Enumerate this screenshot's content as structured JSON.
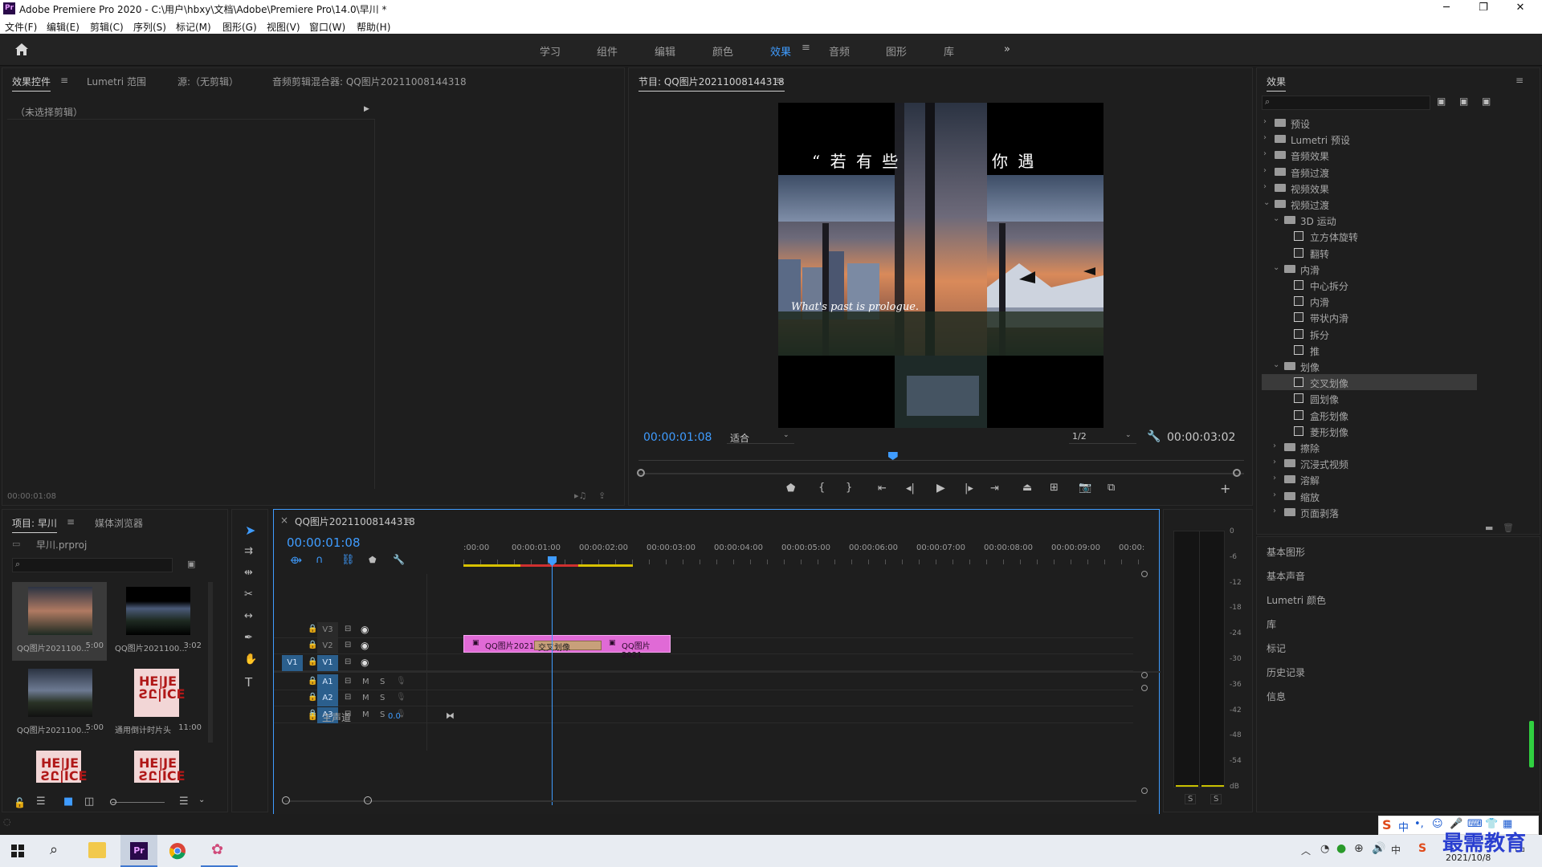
{
  "window": {
    "app_icon": "Pr",
    "title": "Adobe Premiere Pro 2020 - C:\\用户\\hbxy\\文档\\Adobe\\Premiere Pro\\14.0\\早川 *",
    "min": "─",
    "max": "❐",
    "close": "✕"
  },
  "menu": [
    "文件(F)",
    "编辑(E)",
    "剪辑(C)",
    "序列(S)",
    "标记(M)",
    "图形(G)",
    "视图(V)",
    "窗口(W)",
    "帮助(H)"
  ],
  "workspaces": {
    "items": [
      "学习",
      "组件",
      "编辑",
      "颜色",
      "效果",
      "音频",
      "图形",
      "库"
    ],
    "active": "效果",
    "more": "»"
  },
  "source_panel": {
    "tabs": [
      "效果控件",
      "Lumetri 范围",
      "源:（无剪辑）",
      "音频剪辑混合器: QQ图片20211008144318"
    ],
    "no_clip": "（未选择剪辑）",
    "timecode": "00:00:01:08"
  },
  "program_monitor": {
    "title": "节目: QQ图片20211008144318",
    "video_text_top_left": "“ 若 有 些",
    "video_text_top_right": "你 遇",
    "video_text_script": "What's past is prologue.",
    "timecode": "00:00:01:08",
    "fit": "适合",
    "resolution": "1/2",
    "duration": "00:00:03:02",
    "playhead_fraction": 0.42
  },
  "effects_panel": {
    "title": "效果",
    "tree": [
      {
        "level": 0,
        "type": "folder",
        "open": false,
        "label": "预设"
      },
      {
        "level": 0,
        "type": "folder",
        "open": false,
        "label": "Lumetri 预设"
      },
      {
        "level": 0,
        "type": "folder",
        "open": false,
        "label": "音频效果"
      },
      {
        "level": 0,
        "type": "folder",
        "open": false,
        "label": "音频过渡"
      },
      {
        "level": 0,
        "type": "folder",
        "open": false,
        "label": "视频效果"
      },
      {
        "level": 0,
        "type": "folder",
        "open": true,
        "label": "视频过渡"
      },
      {
        "level": 1,
        "type": "folder",
        "open": true,
        "label": "3D 运动"
      },
      {
        "level": 2,
        "type": "fx",
        "label": "立方体旋转"
      },
      {
        "level": 2,
        "type": "fx",
        "label": "翻转"
      },
      {
        "level": 1,
        "type": "folder",
        "open": true,
        "label": "内滑"
      },
      {
        "level": 2,
        "type": "fx",
        "label": "中心拆分"
      },
      {
        "level": 2,
        "type": "fx",
        "label": "内滑"
      },
      {
        "level": 2,
        "type": "fx",
        "label": "带状内滑"
      },
      {
        "level": 2,
        "type": "fx",
        "label": "拆分"
      },
      {
        "level": 2,
        "type": "fx",
        "label": "推"
      },
      {
        "level": 1,
        "type": "folder",
        "open": true,
        "label": "划像"
      },
      {
        "level": 2,
        "type": "fx",
        "label": "交叉划像",
        "selected": true
      },
      {
        "level": 2,
        "type": "fx",
        "label": "圆划像"
      },
      {
        "level": 2,
        "type": "fx",
        "label": "盒形划像"
      },
      {
        "level": 2,
        "type": "fx",
        "label": "菱形划像"
      },
      {
        "level": 1,
        "type": "folder",
        "open": false,
        "label": "擦除"
      },
      {
        "level": 1,
        "type": "folder",
        "open": false,
        "label": "沉浸式视频"
      },
      {
        "level": 1,
        "type": "folder",
        "open": false,
        "label": "溶解"
      },
      {
        "level": 1,
        "type": "folder",
        "open": false,
        "label": "缩放"
      },
      {
        "level": 1,
        "type": "folder",
        "open": false,
        "label": "页面剥落"
      }
    ],
    "side_panels": [
      "基本图形",
      "基本声音",
      "Lumetri 颜色",
      "库",
      "标记",
      "历史记录",
      "信息"
    ]
  },
  "project_panel": {
    "tabs": [
      "项目: 早川",
      "媒体浏览器"
    ],
    "file": "早川.prproj",
    "items": [
      {
        "name": "QQ图片2021100...",
        "dur": "5:00",
        "kind": "photo1"
      },
      {
        "name": "QQ图片2021100...",
        "dur": "3:02",
        "kind": "photo2"
      },
      {
        "name": "QQ图片2021100...",
        "dur": "5:00",
        "kind": "photo3"
      },
      {
        "name": "通用倒计时片头",
        "dur": "11:00",
        "kind": "leader"
      },
      {
        "name": "",
        "dur": "",
        "kind": "leader"
      },
      {
        "name": "",
        "dur": "",
        "kind": "leader"
      }
    ]
  },
  "timeline": {
    "title": "QQ图片20211008144318",
    "timecode": "00:00:01:08",
    "ruler": [
      ":00:00",
      "00:00:01:00",
      "00:00:02:00",
      "00:00:03:00",
      "00:00:04:00",
      "00:00:05:00",
      "00:00:06:00",
      "00:00:07:00",
      "00:00:08:00",
      "00:00:09:00",
      "00:00:"
    ],
    "tracks": [
      {
        "id": "V3",
        "src": ""
      },
      {
        "id": "V2",
        "src": ""
      },
      {
        "id": "V1",
        "src": "V1"
      },
      {
        "id": "A1",
        "src": ""
      },
      {
        "id": "A2",
        "src": ""
      },
      {
        "id": "A3",
        "src": ""
      }
    ],
    "master_label": "主声道",
    "master_value": "0.0",
    "clip_a": "QQ图片2021",
    "clip_b": "QQ图片2021",
    "transition": "交叉划像",
    "m": "M",
    "s": "S"
  },
  "meter": {
    "labels": [
      "0",
      "-6",
      "-12",
      "-18",
      "-24",
      "-30",
      "-36",
      "-42",
      "-48",
      "-54",
      "dB"
    ],
    "solo": [
      "S",
      "S"
    ]
  },
  "taskbar": {
    "date": "2021/10/8",
    "time": "",
    "ime": "中",
    "watermark": "最需教育"
  },
  "colors": {
    "accent": "#3f9cff",
    "clip": "#e06ad6",
    "transition": "#c8a07a",
    "track_selected": "#2b5f8d"
  }
}
